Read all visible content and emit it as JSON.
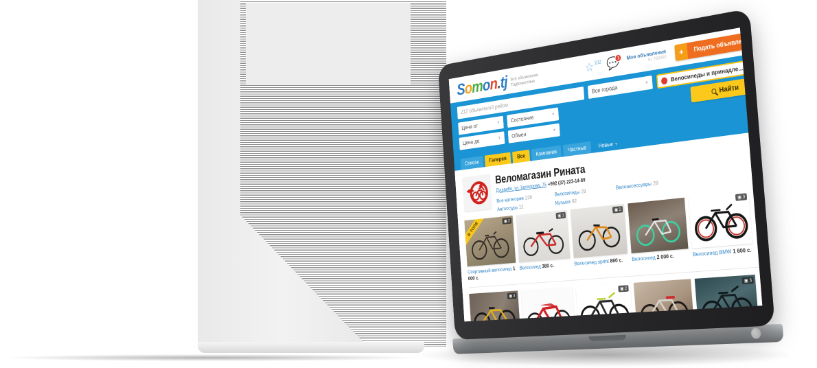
{
  "site": {
    "logo_text": "Somon.tj",
    "tagline_line1": "Все объявления",
    "tagline_line2": "Таджикистана"
  },
  "topbar": {
    "favorites_icon": "star-icon",
    "favorites_count": "102",
    "messages_icon": "message-bubble-icon",
    "messages_badge": "1",
    "my_ads_title": "Мои объявления",
    "my_ads_sub": "91 790000",
    "post_ad_plus": "+",
    "post_ad_label": "Подать объявление"
  },
  "search": {
    "nearby_text": "212 объявлений рядом",
    "city_value": "Все города",
    "category_value": "Велосипеды и принадле...",
    "category_dot_color": "#e03b2f",
    "price_from": "Цена от",
    "price_to": "Цена до",
    "condition": "Состояние",
    "exchange": "Обмен",
    "find_button": "Найти",
    "find_icon": "magnifier-icon"
  },
  "tabs": [
    {
      "label": "Список",
      "state": "dim"
    },
    {
      "label": "Галерея",
      "state": "on"
    },
    {
      "label": "Все",
      "state": "on"
    },
    {
      "label": "Компании",
      "state": "dim"
    },
    {
      "label": "Частные",
      "state": "dim"
    }
  ],
  "sort": {
    "label": "Новые",
    "icon": "chevron-down-icon"
  },
  "store": {
    "logo_icon": "cyclist-emblem-icon",
    "name": "Веломагазин Рината",
    "address": "Душанбе, ул. Каххорова, 75",
    "phone": "+992 (37) 223-14-89",
    "categories": [
      {
        "label": "Все категории",
        "count": "229"
      },
      {
        "label": "Велосипеды",
        "count": "29"
      },
      {
        "label": "Велоаксессуары",
        "count": "29"
      },
      {
        "label": "Автоссуды",
        "count": "12"
      },
      {
        "label": "Музыка",
        "count": "92"
      }
    ]
  },
  "products_row1": [
    {
      "title": "Спортивный велосипед",
      "price": "1 000 с.",
      "photos": "2",
      "top": "В ТОПЕ"
    },
    {
      "title": "Велосипед",
      "price": "380 с.",
      "photos": "1",
      "top": ""
    },
    {
      "title": "Велосипед sprint",
      "price": "860 с.",
      "photos": "2",
      "top": ""
    },
    {
      "title": "Велосипед",
      "price": "2 000 с.",
      "photos": "",
      "top": ""
    },
    {
      "title": "Велосипед BMW",
      "price": "1 600 с.",
      "photos": "3",
      "top": ""
    }
  ],
  "products_row2": [
    {
      "title": "",
      "price": "",
      "photos": "3",
      "top": ""
    },
    {
      "title": "",
      "price": "",
      "photos": "",
      "top": ""
    },
    {
      "title": "",
      "price": "",
      "photos": "2",
      "top": ""
    },
    {
      "title": "",
      "price": "",
      "photos": "",
      "top": ""
    },
    {
      "title": "",
      "price": "",
      "photos": "3",
      "top": ""
    }
  ],
  "colors": {
    "brand_blue": "#1a94d4",
    "accent_yellow": "#fbc91b",
    "accent_orange": "#ef6d1e",
    "link_blue": "#2f86c8"
  }
}
